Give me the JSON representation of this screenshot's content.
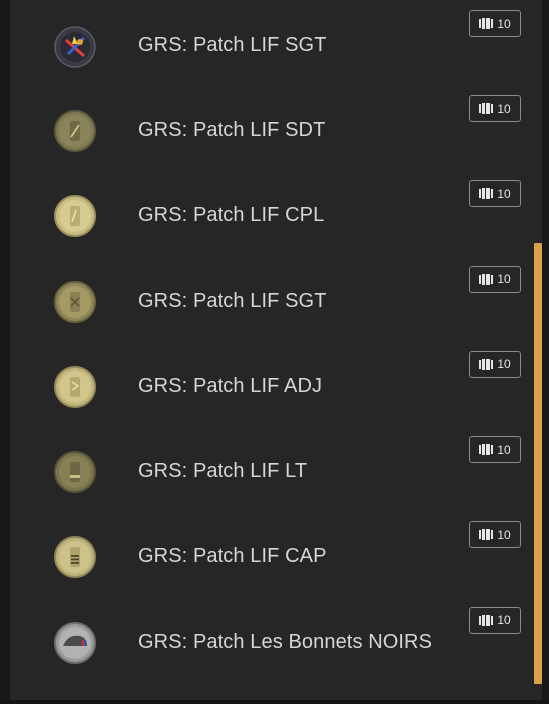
{
  "items": [
    {
      "title": "GRS: Patch LIF SGT",
      "count": "10",
      "icon": "sgt-colored-patch-icon"
    },
    {
      "title": "GRS: Patch LIF SDT",
      "count": "10",
      "icon": "sdt-patch-icon"
    },
    {
      "title": "GRS: Patch LIF CPL",
      "count": "10",
      "icon": "cpl-patch-icon"
    },
    {
      "title": "GRS: Patch LIF SGT",
      "count": "10",
      "icon": "sgt-patch-icon"
    },
    {
      "title": "GRS: Patch LIF ADJ",
      "count": "10",
      "icon": "adj-patch-icon"
    },
    {
      "title": "GRS: Patch LIF LT",
      "count": "10",
      "icon": "lt-patch-icon"
    },
    {
      "title": "GRS: Patch LIF CAP",
      "count": "10",
      "icon": "cap-patch-icon"
    },
    {
      "title": "GRS: Patch Les Bonnets NOIRS",
      "count": "10",
      "icon": "bonnets-noirs-patch-icon"
    }
  ],
  "colors": {
    "panel_bg": "#262626",
    "text": "#d6d6d6",
    "badge_border": "#8a8a8a",
    "scrollbar": "#d9a24a",
    "patch_tan": "#cfc48c",
    "patch_olive": "#7f7a52"
  },
  "icons": {
    "badge": "stack-icon"
  }
}
